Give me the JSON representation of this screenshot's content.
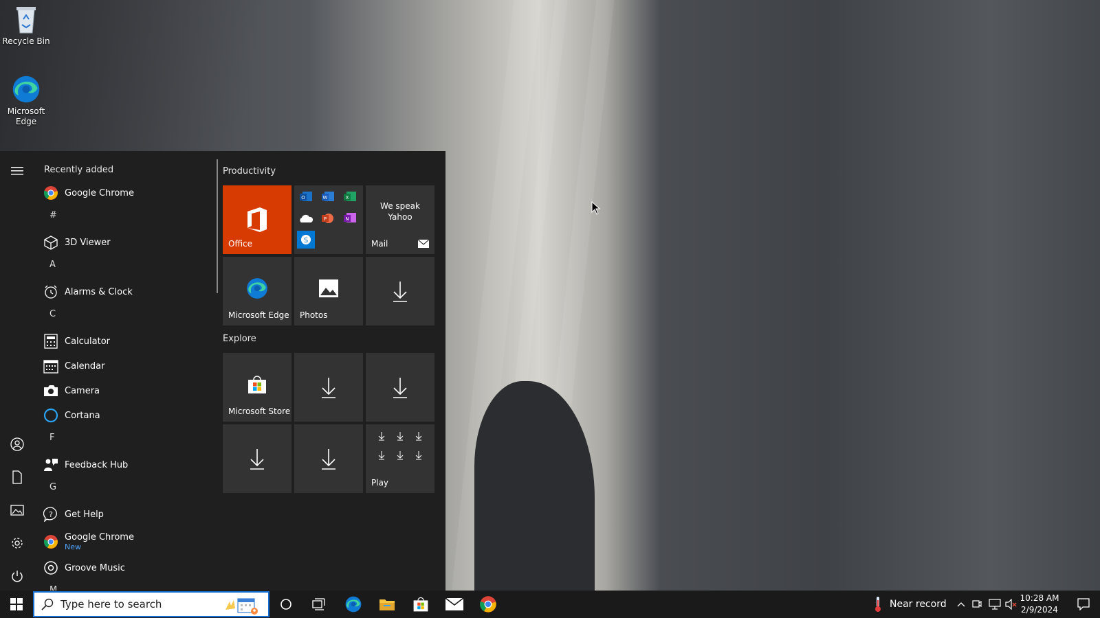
{
  "desktop": {
    "icons": [
      {
        "label": "Recycle Bin",
        "icon": "recycle-bin-icon"
      },
      {
        "label": "Microsoft\nEdge",
        "icon": "edge-icon"
      }
    ]
  },
  "start_menu": {
    "rail": {
      "menu_icon": "hamburger-icon",
      "bottom": [
        "user-icon",
        "documents-icon",
        "pictures-icon",
        "settings-icon",
        "power-icon"
      ]
    },
    "recently_added_label": "Recently added",
    "recent_item": {
      "label": "Google Chrome",
      "icon": "chrome-icon"
    },
    "letters": [
      "#",
      "A",
      "C",
      "F",
      "G",
      "M"
    ],
    "apps": [
      {
        "label": "3D Viewer",
        "icon": "cube-icon"
      },
      {
        "label": "Alarms & Clock",
        "icon": "alarm-clock-icon"
      },
      {
        "label": "Calculator",
        "icon": "calculator-icon"
      },
      {
        "label": "Calendar",
        "icon": "calendar-icon"
      },
      {
        "label": "Camera",
        "icon": "camera-icon"
      },
      {
        "label": "Cortana",
        "icon": "cortana-icon"
      },
      {
        "label": "Feedback Hub",
        "icon": "feedback-hub-icon"
      },
      {
        "label": "Get Help",
        "icon": "help-icon"
      },
      {
        "label": "Google Chrome",
        "badge": "New",
        "icon": "chrome-icon"
      },
      {
        "label": "Groove Music",
        "icon": "groove-music-icon"
      }
    ],
    "tiles": {
      "productivity_title": "Productivity",
      "explore_title": "Explore",
      "office": {
        "label": "Office",
        "color": "#d83b01"
      },
      "mail": {
        "label": "Mail",
        "promo": "We speak Yahoo"
      },
      "edge": {
        "label": "Microsoft Edge"
      },
      "photos": {
        "label": "Photos"
      },
      "store": {
        "label": "Microsoft Store"
      },
      "play": {
        "label": "Play"
      }
    }
  },
  "taskbar": {
    "search_placeholder": "Type here to search",
    "weather_text": "Near record",
    "time": "10:28 AM",
    "date": "2/9/2024",
    "accent": "#1570d6"
  }
}
